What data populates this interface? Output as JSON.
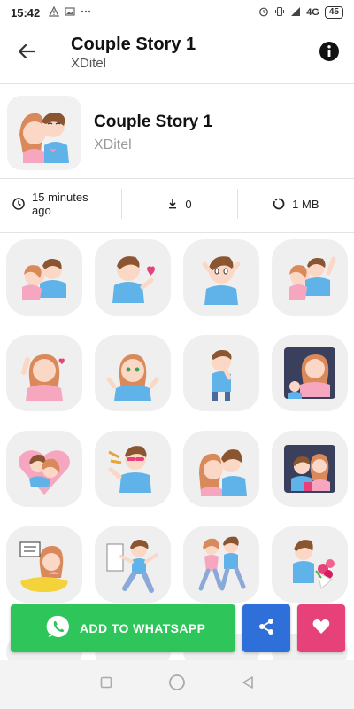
{
  "status_bar": {
    "time": "15:42",
    "network": "4G",
    "battery": "45",
    "left_icons": [
      "warning-icon",
      "image-icon",
      "dots-icon"
    ],
    "right_icons": [
      "alarm-icon",
      "vibrate-icon",
      "signal-icon",
      "battery-icon"
    ]
  },
  "appbar": {
    "title": "Couple Story 1",
    "subtitle": "XDitel",
    "back_icon": "arrow-left-icon",
    "info_icon": "info-icon"
  },
  "pack": {
    "title": "Couple Story 1",
    "author": "XDitel"
  },
  "stats": {
    "updated": "15 minutes ago",
    "downloads": "0",
    "size": "1 MB"
  },
  "stickers": [
    {
      "name": "sticker-couple-hug"
    },
    {
      "name": "sticker-boy-kiss-heart"
    },
    {
      "name": "sticker-boy-worried"
    },
    {
      "name": "sticker-couple-cheer"
    },
    {
      "name": "sticker-girl-wave"
    },
    {
      "name": "sticker-girl-shrug"
    },
    {
      "name": "sticker-boy-thinking"
    },
    {
      "name": "sticker-girl-tv"
    },
    {
      "name": "sticker-couple-heart"
    },
    {
      "name": "sticker-boy-sunglasses"
    },
    {
      "name": "sticker-girl-kiss-boy"
    },
    {
      "name": "sticker-couple-movie"
    },
    {
      "name": "sticker-girl-bath-sign"
    },
    {
      "name": "sticker-boy-dance"
    },
    {
      "name": "sticker-couple-dance"
    },
    {
      "name": "sticker-boy-flowers"
    }
  ],
  "actions": {
    "add_label": "ADD TO WHATSAPP",
    "share_icon": "share-icon",
    "favorite_icon": "heart-icon"
  },
  "colors": {
    "whatsapp_green": "#2ec65a",
    "share_blue": "#2f6fd9",
    "favorite_pink": "#e64178",
    "tile_bg": "#efefef"
  }
}
